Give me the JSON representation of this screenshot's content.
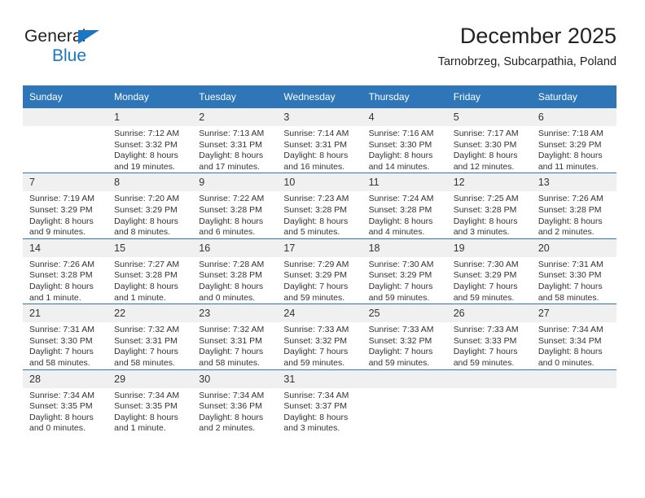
{
  "brand": {
    "line1": "General",
    "line2": "Blue",
    "accent_color": "#1b77c4"
  },
  "header": {
    "month_title": "December 2025",
    "location": "Tarnobrzeg, Subcarpathia, Poland"
  },
  "theme": {
    "header_bg": "#2e76b7",
    "daynum_bg": "#f0f0f0",
    "text": "#333333"
  },
  "calendar": {
    "weekday_headers": [
      "Sunday",
      "Monday",
      "Tuesday",
      "Wednesday",
      "Thursday",
      "Friday",
      "Saturday"
    ],
    "labels": {
      "sunrise": "Sunrise:",
      "sunset": "Sunset:",
      "daylight": "Daylight:"
    },
    "weeks": [
      [
        {
          "day": "",
          "empty": true
        },
        {
          "day": "1",
          "sunrise": "Sunrise: 7:12 AM",
          "sunset": "Sunset: 3:32 PM",
          "daylight_line1": "Daylight: 8 hours",
          "daylight_line2": "and 19 minutes."
        },
        {
          "day": "2",
          "sunrise": "Sunrise: 7:13 AM",
          "sunset": "Sunset: 3:31 PM",
          "daylight_line1": "Daylight: 8 hours",
          "daylight_line2": "and 17 minutes."
        },
        {
          "day": "3",
          "sunrise": "Sunrise: 7:14 AM",
          "sunset": "Sunset: 3:31 PM",
          "daylight_line1": "Daylight: 8 hours",
          "daylight_line2": "and 16 minutes."
        },
        {
          "day": "4",
          "sunrise": "Sunrise: 7:16 AM",
          "sunset": "Sunset: 3:30 PM",
          "daylight_line1": "Daylight: 8 hours",
          "daylight_line2": "and 14 minutes."
        },
        {
          "day": "5",
          "sunrise": "Sunrise: 7:17 AM",
          "sunset": "Sunset: 3:30 PM",
          "daylight_line1": "Daylight: 8 hours",
          "daylight_line2": "and 12 minutes."
        },
        {
          "day": "6",
          "sunrise": "Sunrise: 7:18 AM",
          "sunset": "Sunset: 3:29 PM",
          "daylight_line1": "Daylight: 8 hours",
          "daylight_line2": "and 11 minutes."
        }
      ],
      [
        {
          "day": "7",
          "sunrise": "Sunrise: 7:19 AM",
          "sunset": "Sunset: 3:29 PM",
          "daylight_line1": "Daylight: 8 hours",
          "daylight_line2": "and 9 minutes."
        },
        {
          "day": "8",
          "sunrise": "Sunrise: 7:20 AM",
          "sunset": "Sunset: 3:29 PM",
          "daylight_line1": "Daylight: 8 hours",
          "daylight_line2": "and 8 minutes."
        },
        {
          "day": "9",
          "sunrise": "Sunrise: 7:22 AM",
          "sunset": "Sunset: 3:28 PM",
          "daylight_line1": "Daylight: 8 hours",
          "daylight_line2": "and 6 minutes."
        },
        {
          "day": "10",
          "sunrise": "Sunrise: 7:23 AM",
          "sunset": "Sunset: 3:28 PM",
          "daylight_line1": "Daylight: 8 hours",
          "daylight_line2": "and 5 minutes."
        },
        {
          "day": "11",
          "sunrise": "Sunrise: 7:24 AM",
          "sunset": "Sunset: 3:28 PM",
          "daylight_line1": "Daylight: 8 hours",
          "daylight_line2": "and 4 minutes."
        },
        {
          "day": "12",
          "sunrise": "Sunrise: 7:25 AM",
          "sunset": "Sunset: 3:28 PM",
          "daylight_line1": "Daylight: 8 hours",
          "daylight_line2": "and 3 minutes."
        },
        {
          "day": "13",
          "sunrise": "Sunrise: 7:26 AM",
          "sunset": "Sunset: 3:28 PM",
          "daylight_line1": "Daylight: 8 hours",
          "daylight_line2": "and 2 minutes."
        }
      ],
      [
        {
          "day": "14",
          "sunrise": "Sunrise: 7:26 AM",
          "sunset": "Sunset: 3:28 PM",
          "daylight_line1": "Daylight: 8 hours",
          "daylight_line2": "and 1 minute."
        },
        {
          "day": "15",
          "sunrise": "Sunrise: 7:27 AM",
          "sunset": "Sunset: 3:28 PM",
          "daylight_line1": "Daylight: 8 hours",
          "daylight_line2": "and 1 minute."
        },
        {
          "day": "16",
          "sunrise": "Sunrise: 7:28 AM",
          "sunset": "Sunset: 3:28 PM",
          "daylight_line1": "Daylight: 8 hours",
          "daylight_line2": "and 0 minutes."
        },
        {
          "day": "17",
          "sunrise": "Sunrise: 7:29 AM",
          "sunset": "Sunset: 3:29 PM",
          "daylight_line1": "Daylight: 7 hours",
          "daylight_line2": "and 59 minutes."
        },
        {
          "day": "18",
          "sunrise": "Sunrise: 7:30 AM",
          "sunset": "Sunset: 3:29 PM",
          "daylight_line1": "Daylight: 7 hours",
          "daylight_line2": "and 59 minutes."
        },
        {
          "day": "19",
          "sunrise": "Sunrise: 7:30 AM",
          "sunset": "Sunset: 3:29 PM",
          "daylight_line1": "Daylight: 7 hours",
          "daylight_line2": "and 59 minutes."
        },
        {
          "day": "20",
          "sunrise": "Sunrise: 7:31 AM",
          "sunset": "Sunset: 3:30 PM",
          "daylight_line1": "Daylight: 7 hours",
          "daylight_line2": "and 58 minutes."
        }
      ],
      [
        {
          "day": "21",
          "sunrise": "Sunrise: 7:31 AM",
          "sunset": "Sunset: 3:30 PM",
          "daylight_line1": "Daylight: 7 hours",
          "daylight_line2": "and 58 minutes."
        },
        {
          "day": "22",
          "sunrise": "Sunrise: 7:32 AM",
          "sunset": "Sunset: 3:31 PM",
          "daylight_line1": "Daylight: 7 hours",
          "daylight_line2": "and 58 minutes."
        },
        {
          "day": "23",
          "sunrise": "Sunrise: 7:32 AM",
          "sunset": "Sunset: 3:31 PM",
          "daylight_line1": "Daylight: 7 hours",
          "daylight_line2": "and 58 minutes."
        },
        {
          "day": "24",
          "sunrise": "Sunrise: 7:33 AM",
          "sunset": "Sunset: 3:32 PM",
          "daylight_line1": "Daylight: 7 hours",
          "daylight_line2": "and 59 minutes."
        },
        {
          "day": "25",
          "sunrise": "Sunrise: 7:33 AM",
          "sunset": "Sunset: 3:32 PM",
          "daylight_line1": "Daylight: 7 hours",
          "daylight_line2": "and 59 minutes."
        },
        {
          "day": "26",
          "sunrise": "Sunrise: 7:33 AM",
          "sunset": "Sunset: 3:33 PM",
          "daylight_line1": "Daylight: 7 hours",
          "daylight_line2": "and 59 minutes."
        },
        {
          "day": "27",
          "sunrise": "Sunrise: 7:34 AM",
          "sunset": "Sunset: 3:34 PM",
          "daylight_line1": "Daylight: 8 hours",
          "daylight_line2": "and 0 minutes."
        }
      ],
      [
        {
          "day": "28",
          "sunrise": "Sunrise: 7:34 AM",
          "sunset": "Sunset: 3:35 PM",
          "daylight_line1": "Daylight: 8 hours",
          "daylight_line2": "and 0 minutes."
        },
        {
          "day": "29",
          "sunrise": "Sunrise: 7:34 AM",
          "sunset": "Sunset: 3:35 PM",
          "daylight_line1": "Daylight: 8 hours",
          "daylight_line2": "and 1 minute."
        },
        {
          "day": "30",
          "sunrise": "Sunrise: 7:34 AM",
          "sunset": "Sunset: 3:36 PM",
          "daylight_line1": "Daylight: 8 hours",
          "daylight_line2": "and 2 minutes."
        },
        {
          "day": "31",
          "sunrise": "Sunrise: 7:34 AM",
          "sunset": "Sunset: 3:37 PM",
          "daylight_line1": "Daylight: 8 hours",
          "daylight_line2": "and 3 minutes."
        },
        {
          "day": "",
          "empty": true
        },
        {
          "day": "",
          "empty": true
        },
        {
          "day": "",
          "empty": true
        }
      ]
    ]
  }
}
